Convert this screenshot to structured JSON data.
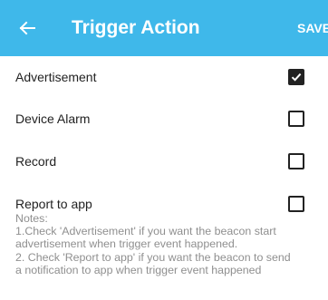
{
  "header": {
    "title": "Trigger Action",
    "save_label": "SAVE",
    "background_color": "#3fb8ea"
  },
  "options": [
    {
      "label": "Advertisement",
      "checked": true
    },
    {
      "label": "Device Alarm",
      "checked": false
    },
    {
      "label": "Record",
      "checked": false
    },
    {
      "label": "Report to app",
      "checked": false
    }
  ],
  "notes": {
    "heading": "Notes:",
    "lines": [
      "1.Check 'Advertisement' if you want the beacon start",
      "advertisement when trigger event happened.",
      "2. Check 'Report to app' if you want the beacon to send",
      "a notification to app when trigger event happened"
    ]
  },
  "icons": {
    "back": "arrow-left-icon",
    "check": "checkmark-icon"
  }
}
